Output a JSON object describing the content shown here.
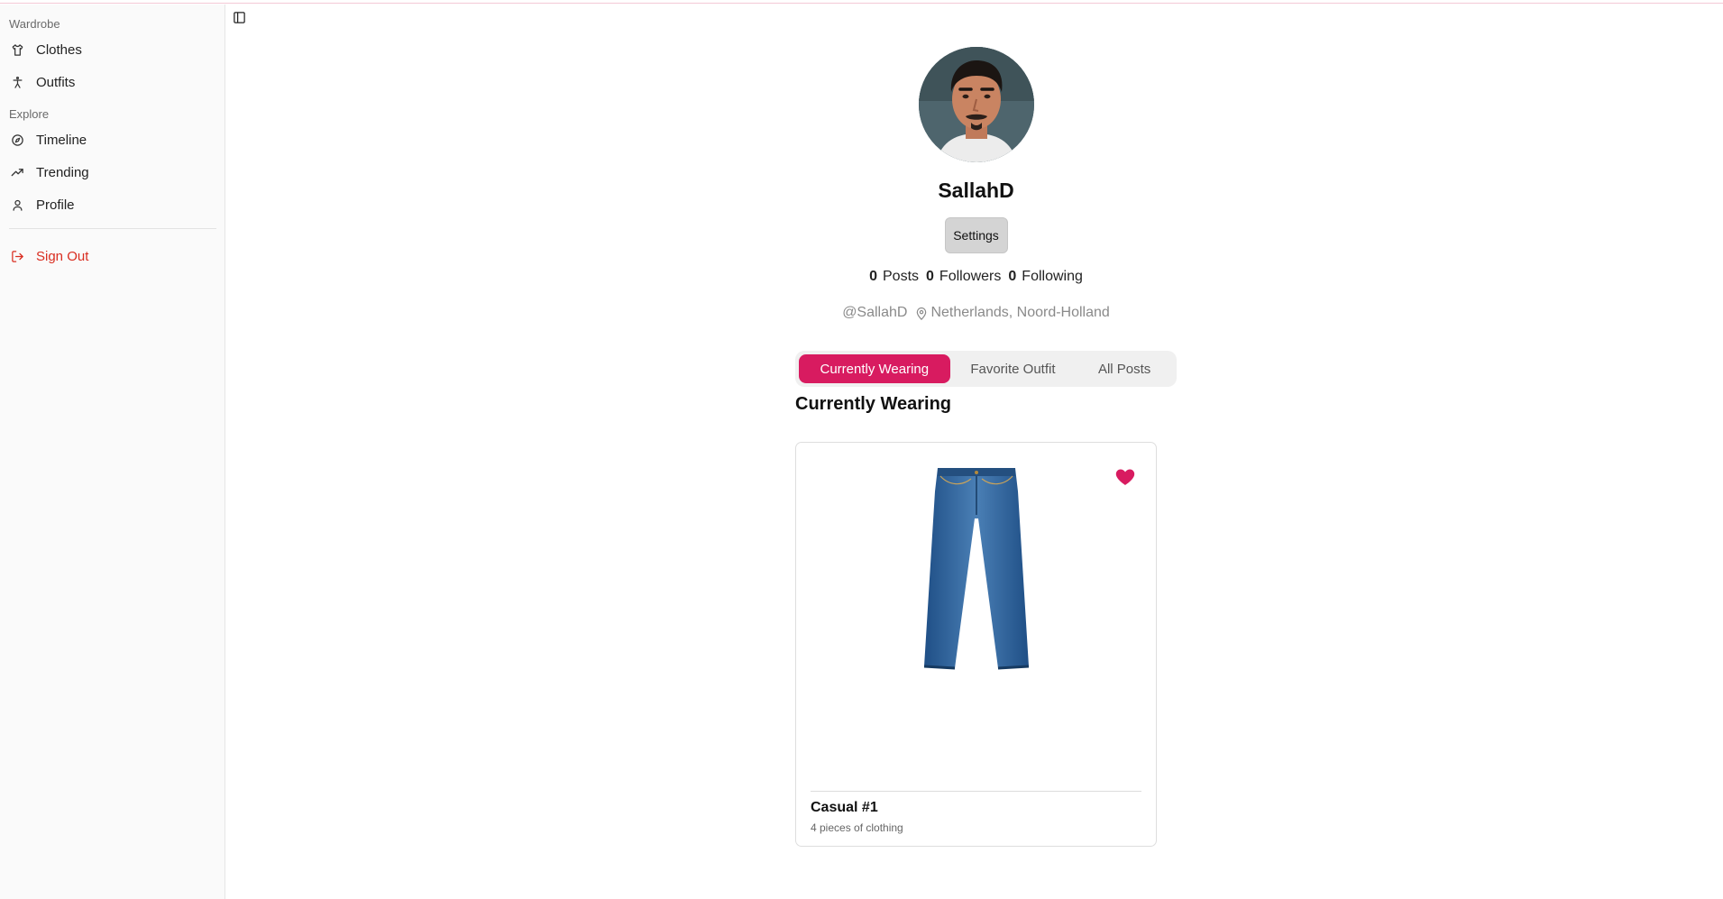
{
  "sidebar": {
    "groups": [
      {
        "label": "Wardrobe",
        "items": [
          {
            "label": "Clothes",
            "icon": "shirt-icon"
          },
          {
            "label": "Outfits",
            "icon": "person-icon"
          }
        ]
      },
      {
        "label": "Explore",
        "items": [
          {
            "label": "Timeline",
            "icon": "compass-icon"
          },
          {
            "label": "Trending",
            "icon": "trending-up-icon"
          },
          {
            "label": "Profile",
            "icon": "user-icon"
          }
        ]
      }
    ],
    "sign_out": {
      "label": "Sign Out",
      "icon": "log-out-icon"
    }
  },
  "profile": {
    "username": "SallahD",
    "settings_label": "Settings",
    "stats": [
      {
        "value": "0",
        "label": "Posts"
      },
      {
        "value": "0",
        "label": "Followers"
      },
      {
        "value": "0",
        "label": "Following"
      }
    ],
    "handle": "@SallahD",
    "location": "Netherlands, Noord-Holland"
  },
  "tabs": [
    {
      "label": "Currently Wearing",
      "active": true
    },
    {
      "label": "Favorite Outfit",
      "active": false
    },
    {
      "label": "All Posts",
      "active": false
    }
  ],
  "section_title": "Currently Wearing",
  "outfit_card": {
    "title": "Casual #1",
    "subtitle": "4 pieces of clothing",
    "favorited": true,
    "image": "jeans-image"
  },
  "colors": {
    "accent": "#d81b60",
    "danger": "#d92d20"
  }
}
